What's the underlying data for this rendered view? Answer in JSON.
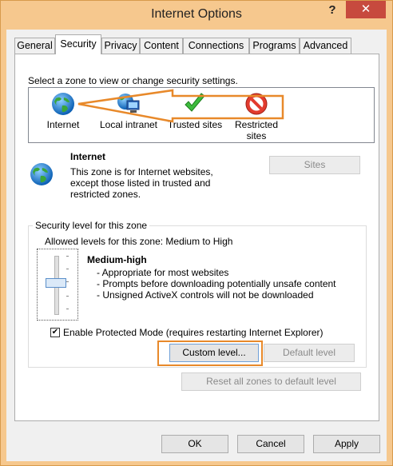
{
  "window": {
    "title": "Internet Options",
    "help_glyph": "?",
    "close_glyph": "✕"
  },
  "tabs": [
    {
      "label": "General"
    },
    {
      "label": "Security"
    },
    {
      "label": "Privacy"
    },
    {
      "label": "Content"
    },
    {
      "label": "Connections"
    },
    {
      "label": "Programs"
    },
    {
      "label": "Advanced"
    }
  ],
  "security": {
    "zone_prompt": "Select a zone to view or change security settings.",
    "zones": [
      {
        "label": "Internet",
        "icon": "globe-icon"
      },
      {
        "label": "Local intranet",
        "icon": "intranet-icon"
      },
      {
        "label": "Trusted sites",
        "icon": "checkmark-icon"
      },
      {
        "label": "Restricted sites",
        "icon": "restricted-icon"
      }
    ],
    "selected_zone": {
      "name": "Internet",
      "desc1": "This zone is for Internet websites,",
      "desc2": "except those listed in trusted and",
      "desc3": "restricted zones."
    },
    "sites_button": "Sites",
    "level_group_label": "Security level for this zone",
    "allowed_levels": "Allowed levels for this zone: Medium to High",
    "level_name": "Medium-high",
    "bullets": [
      "- Appropriate for most websites",
      "- Prompts before downloading potentially unsafe content",
      "- Unsigned ActiveX controls will not be downloaded"
    ],
    "protected_mode_label": "Enable Protected Mode (requires restarting Internet Explorer)",
    "protected_mode_checked": true,
    "custom_level_button": "Custom level...",
    "default_level_button": "Default level",
    "reset_all_button": "Reset all zones to default level"
  },
  "footer": {
    "ok": "OK",
    "cancel": "Cancel",
    "apply": "Apply"
  },
  "colors": {
    "frame": "#f6c88e",
    "close": "#c74a3e",
    "annotation": "#e8892a"
  }
}
